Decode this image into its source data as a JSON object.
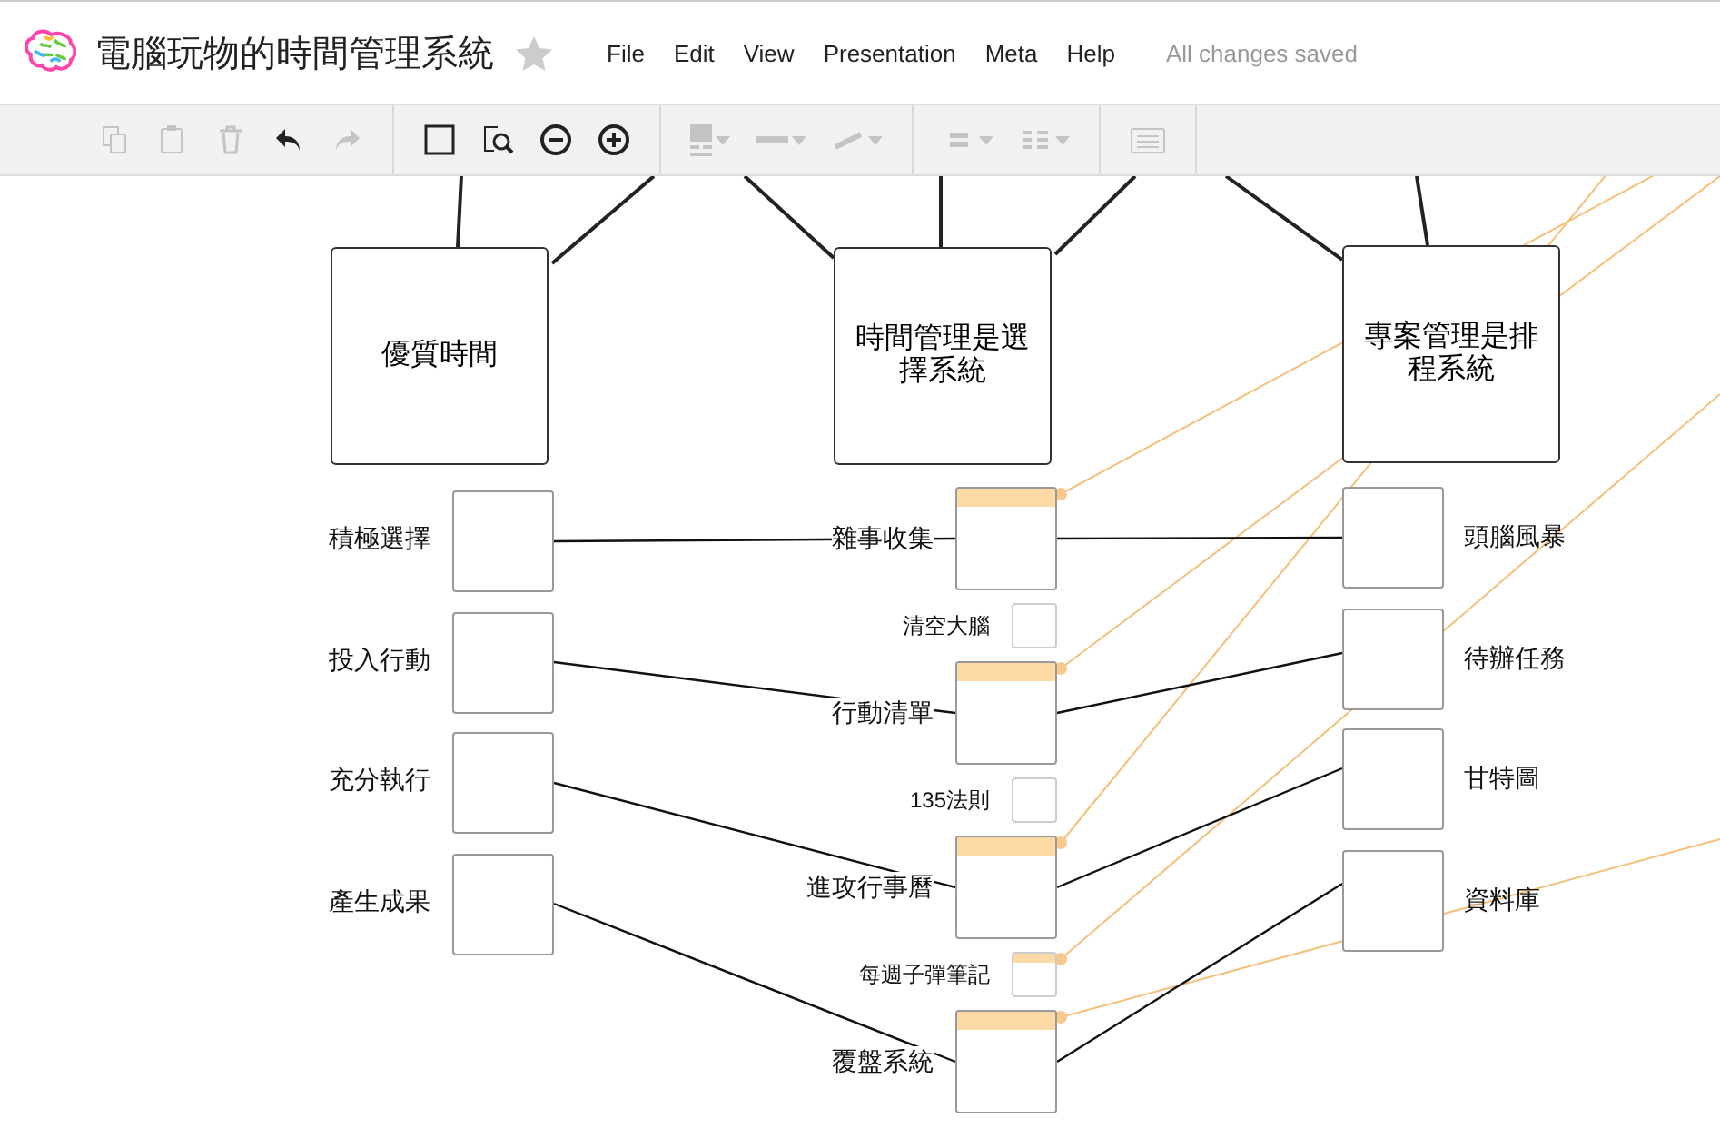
{
  "title": "電腦玩物的時間管理系統",
  "starred": false,
  "menu": [
    "File",
    "Edit",
    "View",
    "Presentation",
    "Meta",
    "Help"
  ],
  "status": "All changes saved",
  "toolbar": [
    [
      {
        "kind": "button",
        "disabled": true
      },
      {
        "kind": "button",
        "disabled": true
      },
      {
        "kind": "button",
        "disabled": true
      },
      {
        "kind": "button",
        "disabled": false
      },
      {
        "kind": "button",
        "disabled": true
      }
    ],
    [
      {
        "kind": "button",
        "disabled": false
      },
      {
        "kind": "button",
        "disabled": false
      },
      {
        "kind": "button",
        "disabled": false
      },
      {
        "kind": "button",
        "disabled": false
      }
    ],
    [
      {
        "kind": "dropdown",
        "disabled": true
      },
      {
        "kind": "dropdown",
        "disabled": true
      },
      {
        "kind": "dropdown",
        "disabled": true
      }
    ],
    [
      {
        "kind": "dropdown",
        "disabled": true
      },
      {
        "kind": "dropdown",
        "disabled": true
      }
    ],
    [
      {
        "kind": "button",
        "disabled": true
      }
    ]
  ],
  "columns": [
    {
      "heading": "優質時間",
      "items": [
        {
          "label": "積極選擇",
          "kind": "topic",
          "highlighted": false
        },
        {
          "label": "投入行動",
          "kind": "topic",
          "highlighted": false
        },
        {
          "label": "充分執行",
          "kind": "topic",
          "highlighted": false
        },
        {
          "label": "產生成果",
          "kind": "topic",
          "highlighted": false
        }
      ]
    },
    {
      "heading": "時間管理是選擇系統",
      "items": [
        {
          "label": "雜事收集",
          "kind": "topic",
          "highlighted": true
        },
        {
          "label": "清空大腦",
          "kind": "note",
          "highlighted": false
        },
        {
          "label": "行動清單",
          "kind": "topic",
          "highlighted": true
        },
        {
          "label": "135法則",
          "kind": "note",
          "highlighted": false
        },
        {
          "label": "進攻行事曆",
          "kind": "topic",
          "highlighted": true
        },
        {
          "label": "每週子彈筆記",
          "kind": "note",
          "highlighted": true
        },
        {
          "label": "覆盤系統",
          "kind": "topic",
          "highlighted": true
        }
      ]
    },
    {
      "heading": "專案管理是排程系統",
      "items": [
        {
          "label": "頭腦風暴",
          "kind": "topic",
          "highlighted": false
        },
        {
          "label": "待辦任務",
          "kind": "topic",
          "highlighted": false
        },
        {
          "label": "甘特圖",
          "kind": "topic",
          "highlighted": false
        },
        {
          "label": "資料庫",
          "kind": "topic",
          "highlighted": false
        }
      ]
    }
  ]
}
